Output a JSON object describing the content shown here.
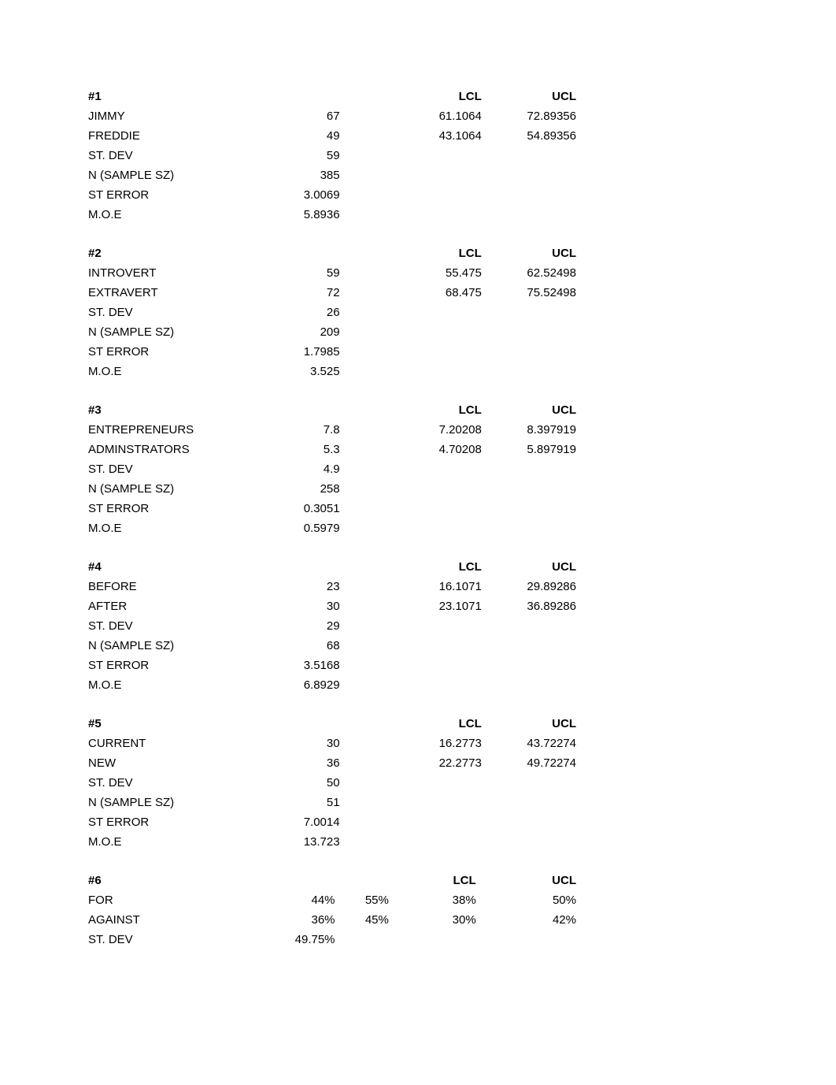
{
  "sections": [
    {
      "id": "#1",
      "lcl_header": "LCL",
      "ucl_header": "UCL",
      "rows": [
        {
          "label": "JIMMY",
          "val": "67",
          "lcl": "61.1064",
          "ucl": "72.89356"
        },
        {
          "label": "FREDDIE",
          "val": "49",
          "lcl": "43.1064",
          "ucl": "54.89356"
        },
        {
          "label": "ST. DEV",
          "val": "59"
        },
        {
          "label": "N (SAMPLE SZ)",
          "val": "385"
        },
        {
          "label": "ST ERROR",
          "val": "3.0069"
        },
        {
          "label": "M.O.E",
          "val": "5.8936"
        }
      ]
    },
    {
      "id": "#2",
      "lcl_header": "LCL",
      "ucl_header": "UCL",
      "rows": [
        {
          "label": "INTROVERT",
          "val": "59",
          "lcl": "55.475",
          "ucl": "62.52498"
        },
        {
          "label": "EXTRAVERT",
          "val": "72",
          "lcl": "68.475",
          "ucl": "75.52498"
        },
        {
          "label": "ST. DEV",
          "val": "26"
        },
        {
          "label": "N (SAMPLE SZ)",
          "val": "209"
        },
        {
          "label": "ST ERROR",
          "val": "1.7985"
        },
        {
          "label": "M.O.E",
          "val": "3.525"
        }
      ]
    },
    {
      "id": "#3",
      "lcl_header": "LCL",
      "ucl_header": "UCL",
      "rows": [
        {
          "label": "ENTREPRENEURS",
          "val": "7.8",
          "lcl": "7.20208",
          "ucl": "8.397919"
        },
        {
          "label": "ADMINSTRATORS",
          "val": "5.3",
          "lcl": "4.70208",
          "ucl": "5.897919"
        },
        {
          "label": "ST. DEV",
          "val": "4.9"
        },
        {
          "label": "N (SAMPLE SZ)",
          "val": "258"
        },
        {
          "label": "ST ERROR",
          "val": "0.3051"
        },
        {
          "label": "M.O.E",
          "val": "0.5979"
        }
      ]
    },
    {
      "id": "#4",
      "lcl_header": "LCL",
      "ucl_header": "UCL",
      "rows": [
        {
          "label": "BEFORE",
          "val": "23",
          "lcl": "16.1071",
          "ucl": "29.89286"
        },
        {
          "label": "AFTER",
          "val": "30",
          "lcl": "23.1071",
          "ucl": "36.89286"
        },
        {
          "label": "ST. DEV",
          "val": "29"
        },
        {
          "label": "N (SAMPLE SZ)",
          "val": "68"
        },
        {
          "label": "ST ERROR",
          "val": "3.5168"
        },
        {
          "label": "M.O.E",
          "val": "6.8929"
        }
      ]
    },
    {
      "id": "#5",
      "lcl_header": "LCL",
      "ucl_header": "UCL",
      "rows": [
        {
          "label": "CURRENT",
          "val": "30",
          "lcl": "16.2773",
          "ucl": "43.72274"
        },
        {
          "label": "NEW",
          "val": "36",
          "lcl": "22.2773",
          "ucl": "49.72274"
        },
        {
          "label": "ST. DEV",
          "val": "50"
        },
        {
          "label": "N (SAMPLE SZ)",
          "val": "51"
        },
        {
          "label": "ST ERROR",
          "val": "7.0014"
        },
        {
          "label": "M.O.E",
          "val": "13.723"
        }
      ]
    }
  ],
  "section6": {
    "id": "#6",
    "lcl_header": "LCL",
    "ucl_header": "UCL",
    "rows": [
      {
        "label": "FOR",
        "val": "44%",
        "extra": "55%",
        "lcl": "38%",
        "ucl": "50%"
      },
      {
        "label": "AGAINST",
        "val": "36%",
        "extra": "45%",
        "lcl": "30%",
        "ucl": "42%"
      },
      {
        "label": "ST. DEV",
        "val": "49.75%"
      }
    ]
  }
}
